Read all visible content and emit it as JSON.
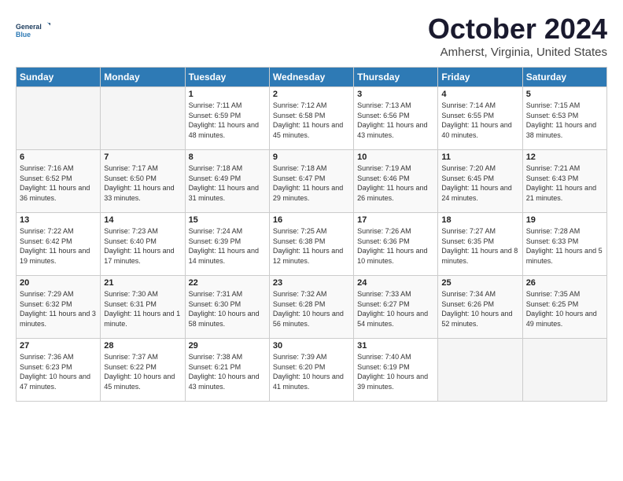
{
  "logo": {
    "line1": "General",
    "line2": "Blue"
  },
  "title": "October 2024",
  "location": "Amherst, Virginia, United States",
  "days_of_week": [
    "Sunday",
    "Monday",
    "Tuesday",
    "Wednesday",
    "Thursday",
    "Friday",
    "Saturday"
  ],
  "weeks": [
    [
      {
        "num": "",
        "empty": true
      },
      {
        "num": "",
        "empty": true
      },
      {
        "num": "1",
        "sunrise": "7:11 AM",
        "sunset": "6:59 PM",
        "daylight": "11 hours and 48 minutes."
      },
      {
        "num": "2",
        "sunrise": "7:12 AM",
        "sunset": "6:58 PM",
        "daylight": "11 hours and 45 minutes."
      },
      {
        "num": "3",
        "sunrise": "7:13 AM",
        "sunset": "6:56 PM",
        "daylight": "11 hours and 43 minutes."
      },
      {
        "num": "4",
        "sunrise": "7:14 AM",
        "sunset": "6:55 PM",
        "daylight": "11 hours and 40 minutes."
      },
      {
        "num": "5",
        "sunrise": "7:15 AM",
        "sunset": "6:53 PM",
        "daylight": "11 hours and 38 minutes."
      }
    ],
    [
      {
        "num": "6",
        "sunrise": "7:16 AM",
        "sunset": "6:52 PM",
        "daylight": "11 hours and 36 minutes."
      },
      {
        "num": "7",
        "sunrise": "7:17 AM",
        "sunset": "6:50 PM",
        "daylight": "11 hours and 33 minutes."
      },
      {
        "num": "8",
        "sunrise": "7:18 AM",
        "sunset": "6:49 PM",
        "daylight": "11 hours and 31 minutes."
      },
      {
        "num": "9",
        "sunrise": "7:18 AM",
        "sunset": "6:47 PM",
        "daylight": "11 hours and 29 minutes."
      },
      {
        "num": "10",
        "sunrise": "7:19 AM",
        "sunset": "6:46 PM",
        "daylight": "11 hours and 26 minutes."
      },
      {
        "num": "11",
        "sunrise": "7:20 AM",
        "sunset": "6:45 PM",
        "daylight": "11 hours and 24 minutes."
      },
      {
        "num": "12",
        "sunrise": "7:21 AM",
        "sunset": "6:43 PM",
        "daylight": "11 hours and 21 minutes."
      }
    ],
    [
      {
        "num": "13",
        "sunrise": "7:22 AM",
        "sunset": "6:42 PM",
        "daylight": "11 hours and 19 minutes."
      },
      {
        "num": "14",
        "sunrise": "7:23 AM",
        "sunset": "6:40 PM",
        "daylight": "11 hours and 17 minutes."
      },
      {
        "num": "15",
        "sunrise": "7:24 AM",
        "sunset": "6:39 PM",
        "daylight": "11 hours and 14 minutes."
      },
      {
        "num": "16",
        "sunrise": "7:25 AM",
        "sunset": "6:38 PM",
        "daylight": "11 hours and 12 minutes."
      },
      {
        "num": "17",
        "sunrise": "7:26 AM",
        "sunset": "6:36 PM",
        "daylight": "11 hours and 10 minutes."
      },
      {
        "num": "18",
        "sunrise": "7:27 AM",
        "sunset": "6:35 PM",
        "daylight": "11 hours and 8 minutes."
      },
      {
        "num": "19",
        "sunrise": "7:28 AM",
        "sunset": "6:33 PM",
        "daylight": "11 hours and 5 minutes."
      }
    ],
    [
      {
        "num": "20",
        "sunrise": "7:29 AM",
        "sunset": "6:32 PM",
        "daylight": "11 hours and 3 minutes."
      },
      {
        "num": "21",
        "sunrise": "7:30 AM",
        "sunset": "6:31 PM",
        "daylight": "11 hours and 1 minute."
      },
      {
        "num": "22",
        "sunrise": "7:31 AM",
        "sunset": "6:30 PM",
        "daylight": "10 hours and 58 minutes."
      },
      {
        "num": "23",
        "sunrise": "7:32 AM",
        "sunset": "6:28 PM",
        "daylight": "10 hours and 56 minutes."
      },
      {
        "num": "24",
        "sunrise": "7:33 AM",
        "sunset": "6:27 PM",
        "daylight": "10 hours and 54 minutes."
      },
      {
        "num": "25",
        "sunrise": "7:34 AM",
        "sunset": "6:26 PM",
        "daylight": "10 hours and 52 minutes."
      },
      {
        "num": "26",
        "sunrise": "7:35 AM",
        "sunset": "6:25 PM",
        "daylight": "10 hours and 49 minutes."
      }
    ],
    [
      {
        "num": "27",
        "sunrise": "7:36 AM",
        "sunset": "6:23 PM",
        "daylight": "10 hours and 47 minutes."
      },
      {
        "num": "28",
        "sunrise": "7:37 AM",
        "sunset": "6:22 PM",
        "daylight": "10 hours and 45 minutes."
      },
      {
        "num": "29",
        "sunrise": "7:38 AM",
        "sunset": "6:21 PM",
        "daylight": "10 hours and 43 minutes."
      },
      {
        "num": "30",
        "sunrise": "7:39 AM",
        "sunset": "6:20 PM",
        "daylight": "10 hours and 41 minutes."
      },
      {
        "num": "31",
        "sunrise": "7:40 AM",
        "sunset": "6:19 PM",
        "daylight": "10 hours and 39 minutes."
      },
      {
        "num": "",
        "empty": true
      },
      {
        "num": "",
        "empty": true
      }
    ]
  ],
  "labels": {
    "sunrise": "Sunrise:",
    "sunset": "Sunset:",
    "daylight": "Daylight:"
  }
}
